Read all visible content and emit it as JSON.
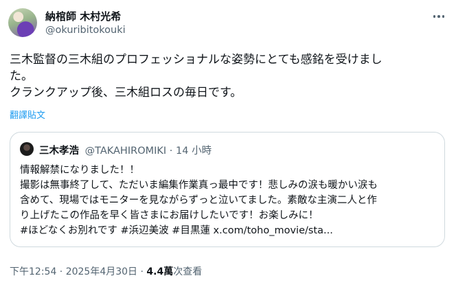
{
  "author": {
    "name": "納棺師 木村光希",
    "handle": "@okuribitokouki"
  },
  "post": {
    "text": "三木監督の三木組のプロフェッショナルな姿勢にとても感銘を受けまし\nた。\nクランクアップ後、三木組ロスの毎日です。",
    "translate_label": "翻譯貼文"
  },
  "quoted": {
    "name": "三木孝浩",
    "handle": "@TAKAHIROMIKI",
    "separator": "·",
    "time": "14 小時",
    "text": "情報解禁になりました！！\n撮影は無事終了して、ただいま編集作業真っ最中です！悲しみの涙も暖かい涙も\n含めて、現場ではモニターを見ながらずっと泣いてました。素敵な主演二人と作\nり上げたこの作品を早く皆さまにお届けしたいです！お楽しみに！\n#ほどなくお別れです #浜辺美波 #目黒蓮 x.com/toho_movie/sta..."
  },
  "meta": {
    "timestamp": "下午12:54 · 2025年4月30日 · ",
    "views_count": "4.4萬",
    "views_label": "次查看"
  },
  "colors": {
    "text": "#0f1419",
    "secondary": "#536471",
    "link": "#1d9bf0",
    "border": "#cfd9de"
  },
  "icons": {
    "more": "more-horizontal-icon"
  }
}
